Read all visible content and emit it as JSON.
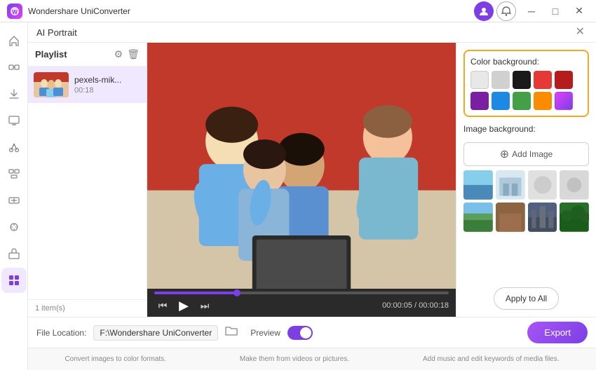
{
  "titlebar": {
    "app_name": "Wondershare UniConverter",
    "logo_text": "W"
  },
  "ai_portrait": {
    "panel_title": "AI Portrait",
    "close_label": "×"
  },
  "playlist": {
    "title": "Playlist",
    "item": {
      "name": "pexels-mik...",
      "duration": "00:18"
    },
    "count_label": "1 item(s)"
  },
  "video": {
    "progress_pct": 28,
    "current_time": "00:00:05",
    "total_time": "00:00:18",
    "play_label": "▶",
    "prev_label": "⏮",
    "next_label": "⏭"
  },
  "right_panel": {
    "color_bg_label": "Color background:",
    "image_bg_label": "Image background:",
    "add_image_label": "Add Image",
    "apply_all_label": "Apply to All",
    "colors": [
      {
        "id": "white",
        "hex": "#e8e8e8"
      },
      {
        "id": "light-gray",
        "hex": "#d0d0d0"
      },
      {
        "id": "black",
        "hex": "#1a1a1a"
      },
      {
        "id": "red",
        "hex": "#e53935"
      },
      {
        "id": "dark-red",
        "hex": "#b71c1c"
      },
      {
        "id": "purple",
        "hex": "#7b1fa2"
      },
      {
        "id": "blue",
        "hex": "#1e88e5"
      },
      {
        "id": "green",
        "hex": "#43a047"
      },
      {
        "id": "orange",
        "hex": "#fb8c00"
      },
      {
        "id": "gradient",
        "hex": "linear-gradient(135deg,#e040fb,#7b3fe4)"
      }
    ],
    "bg_images": [
      {
        "id": "bg1",
        "class": "bg-blue"
      },
      {
        "id": "bg2",
        "class": "bg-room"
      },
      {
        "id": "bg3",
        "class": "bg-light"
      },
      {
        "id": "bg4",
        "class": "bg-gray-circle"
      },
      {
        "id": "bg5",
        "class": "bg-nature"
      },
      {
        "id": "bg6",
        "class": "bg-office"
      },
      {
        "id": "bg7",
        "class": "bg-city"
      },
      {
        "id": "bg8",
        "class": "bg-forest"
      }
    ]
  },
  "bottom_bar": {
    "file_location_label": "File Location:",
    "file_path": "F:\\Wondershare UniConverter",
    "preview_label": "Preview",
    "export_label": "Export"
  },
  "footer": {
    "link1": "Convert images to color formats.",
    "link2": "Make them from videos or pictures.",
    "link3": "Add music and edit keywords of media files."
  },
  "sidebar": {
    "items": [
      {
        "id": "home",
        "icon": "⌂"
      },
      {
        "id": "convert",
        "icon": "↔"
      },
      {
        "id": "download",
        "icon": "↓"
      },
      {
        "id": "screen",
        "icon": "▣"
      },
      {
        "id": "scissors",
        "icon": "✂"
      },
      {
        "id": "merge",
        "icon": "⊞"
      },
      {
        "id": "compress",
        "icon": "⊡"
      },
      {
        "id": "enhance",
        "icon": "◈"
      },
      {
        "id": "toolbox",
        "icon": "⊞"
      },
      {
        "id": "active-tool",
        "icon": "⠿"
      }
    ]
  }
}
